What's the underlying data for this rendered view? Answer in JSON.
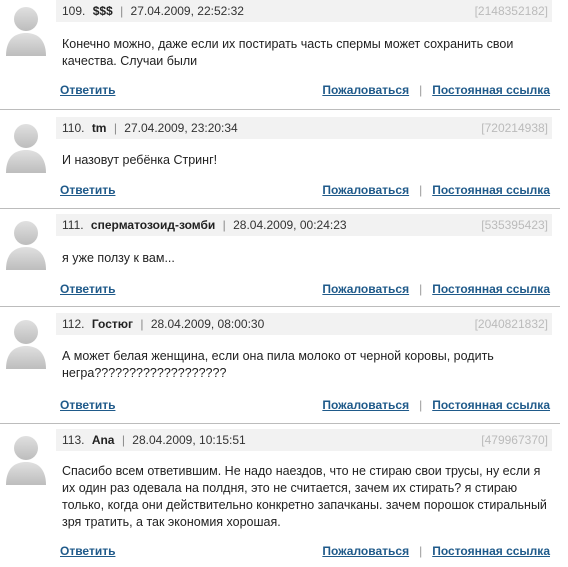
{
  "comments": [
    {
      "num": "109.",
      "author": "$$$",
      "date": "27.04.2009, 22:52:32",
      "cid": "[2148352182]",
      "text": "Конечно можно, даже если их постирать часть спермы может сохранить свои качества. Случаи были",
      "reply": "Ответить",
      "complain": "Пожаловаться",
      "permalink": "Постоянная ссылка"
    },
    {
      "num": "110.",
      "author": "tm",
      "date": "27.04.2009, 23:20:34",
      "cid": "[720214938]",
      "text": "И назовут ребёнка Стринг!",
      "reply": "Ответить",
      "complain": "Пожаловаться",
      "permalink": "Постоянная ссылка"
    },
    {
      "num": "111.",
      "author": "сперматозоид-зомби",
      "date": "28.04.2009, 00:24:23",
      "cid": "[535395423]",
      "text": "я уже ползу к вам...",
      "reply": "Ответить",
      "complain": "Пожаловаться",
      "permalink": "Постоянная ссылка"
    },
    {
      "num": "112.",
      "author": "Гостюг",
      "date": "28.04.2009, 08:00:30",
      "cid": "[2040821832]",
      "text": "А может белая женщина, если она пила молоко от черной коровы, родить негра???????????????????",
      "reply": "Ответить",
      "complain": "Пожаловаться",
      "permalink": "Постоянная ссылка"
    },
    {
      "num": "113.",
      "author": "Ana",
      "date": "28.04.2009, 10:15:51",
      "cid": "[479967370]",
      "text": "Спасибо всем ответившим. Не надо наездов, что не стираю свои трусы, ну если я их один раз одевала на полдня, это не считается, зачем их стирать? я стираю только, когда они действительно конкретно запачканы. зачем порошок стиральный зря тратить, а так экономия хорошая.",
      "reply": "Ответить",
      "complain": "Пожаловаться",
      "permalink": "Постоянная ссылка"
    }
  ],
  "separator": "|"
}
